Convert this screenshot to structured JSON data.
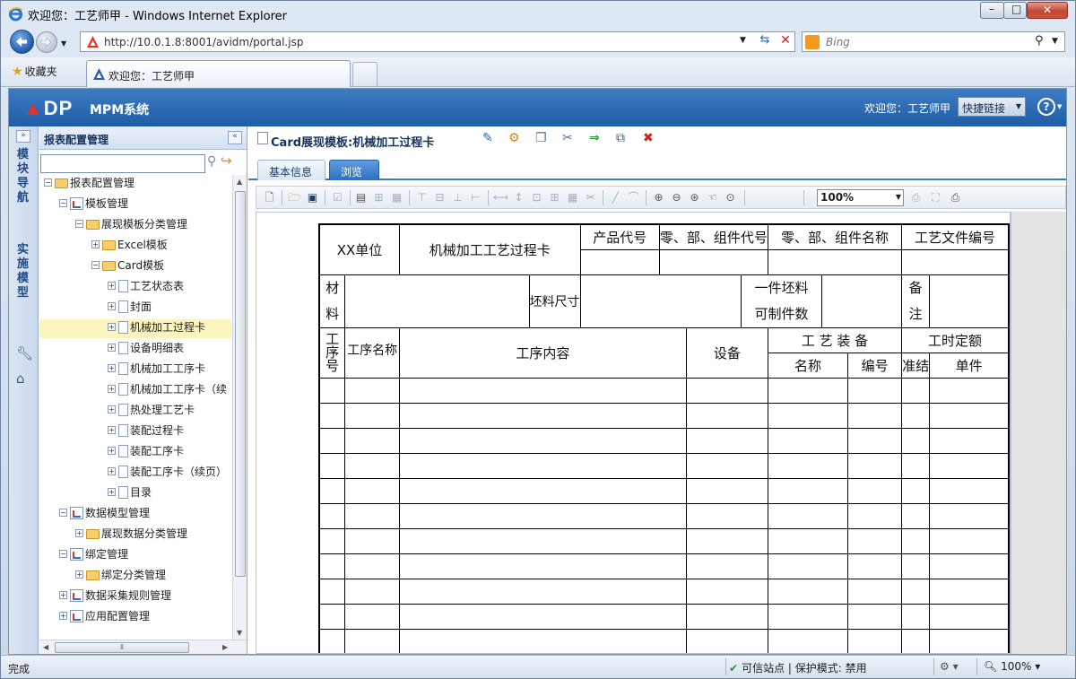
{
  "window": {
    "title": "欢迎您：工艺师甲 - Windows Internet Explorer",
    "minimize_glyph": "–",
    "maximize_glyph": "□",
    "close_glyph": "✕"
  },
  "addressbar": {
    "url": "http://10.0.1.8:8001/avidm/portal.jsp",
    "search_placeholder": "Bing"
  },
  "favorites": {
    "label": "收藏夹",
    "active_tab": "欢迎您：工艺师甲"
  },
  "app": {
    "logo_triangle": "▲",
    "logo_text": "DP",
    "title": "MPM系统",
    "welcome": "欢迎您：工艺师甲",
    "quick_links": "快捷链接",
    "help_glyph": "?"
  },
  "vnav": {
    "module_nav": "模块导航",
    "implementation_model": "实施模型"
  },
  "tree": {
    "title": "报表配置管理",
    "items": [
      {
        "label": "报表配置管理",
        "level": 0,
        "toggle": "−",
        "icon": "folder"
      },
      {
        "label": "模板管理",
        "level": 1,
        "toggle": "−",
        "icon": "template"
      },
      {
        "label": "展现模板分类管理",
        "level": 2,
        "toggle": "−",
        "icon": "folder"
      },
      {
        "label": "Excel模板",
        "level": 3,
        "toggle": "+",
        "icon": "folder"
      },
      {
        "label": "Card模板",
        "level": 3,
        "toggle": "−",
        "icon": "folder"
      },
      {
        "label": "工艺状态表",
        "level": 4,
        "toggle": "+",
        "icon": "doc"
      },
      {
        "label": "封面",
        "level": 4,
        "toggle": "+",
        "icon": "doc"
      },
      {
        "label": "机械加工过程卡",
        "level": 4,
        "toggle": "+",
        "icon": "doc",
        "selected": true
      },
      {
        "label": "设备明细表",
        "level": 4,
        "toggle": "+",
        "icon": "doc"
      },
      {
        "label": "机械加工工序卡",
        "level": 4,
        "toggle": "+",
        "icon": "doc"
      },
      {
        "label": "机械加工工序卡（续",
        "level": 4,
        "toggle": "+",
        "icon": "doc"
      },
      {
        "label": "热处理工艺卡",
        "level": 4,
        "toggle": "+",
        "icon": "doc"
      },
      {
        "label": "装配过程卡",
        "level": 4,
        "toggle": "+",
        "icon": "doc"
      },
      {
        "label": "装配工序卡",
        "level": 4,
        "toggle": "+",
        "icon": "doc"
      },
      {
        "label": "装配工序卡（续页）",
        "level": 4,
        "toggle": "+",
        "icon": "doc"
      },
      {
        "label": "目录",
        "level": 4,
        "toggle": "+",
        "icon": "doc"
      },
      {
        "label": "数据模型管理",
        "level": 1,
        "toggle": "−",
        "icon": "template"
      },
      {
        "label": "展现数据分类管理",
        "level": 2,
        "toggle": "+",
        "icon": "folder"
      },
      {
        "label": "绑定管理",
        "level": 1,
        "toggle": "−",
        "icon": "template"
      },
      {
        "label": "绑定分类管理",
        "level": 2,
        "toggle": "+",
        "icon": "folder"
      },
      {
        "label": "数据采集规则管理",
        "level": 1,
        "toggle": "+",
        "icon": "template"
      },
      {
        "label": "应用配置管理",
        "level": 1,
        "toggle": "+",
        "icon": "template"
      }
    ]
  },
  "content": {
    "title": "Card展现模板:机械加工过程卡",
    "tabs": [
      "基本信息",
      "浏览"
    ],
    "zoom": "100%"
  },
  "report": {
    "unit": "XX单位",
    "card_name": "机械加工工艺过程卡",
    "product_code": "产品代号",
    "part_code": "零、部、组件代号",
    "part_name": "零、部、组件名称",
    "doc_number": "工艺文件编号",
    "material_1": "材",
    "material_2": "料",
    "blank_size": "坯料尺寸",
    "per_blank_1": "一件坯料",
    "per_blank_2": "可制件数",
    "remark_1": "备",
    "remark_2": "注",
    "op_no_1": "工",
    "op_no_2": "序",
    "op_no_3": "号",
    "op_name": "工序名称",
    "op_content": "工序内容",
    "equipment": "设备",
    "tooling": "工 艺 装 备",
    "time_quota": "工时定额",
    "tool_name": "名称",
    "tool_no": "编号",
    "prep": "准结",
    "unit_time": "单件"
  },
  "status": {
    "left": "完成",
    "zone": "可信站点 | 保护模式: 禁用",
    "zoom": "100%"
  }
}
